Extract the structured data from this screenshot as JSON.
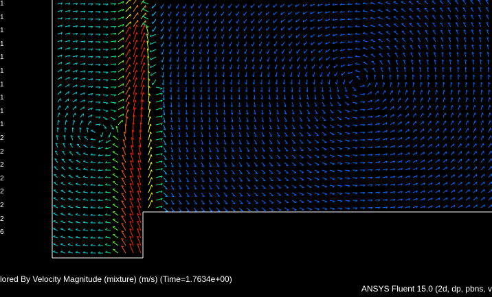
{
  "legend": {
    "labels": [
      "1",
      "1",
      "1",
      "1",
      "1",
      "1",
      "1",
      "1",
      "1",
      "1",
      "2",
      "2",
      "2",
      "2",
      "2",
      "2",
      "2",
      "6"
    ]
  },
  "caption": "lored By Velocity Magnitude (mixture)  (m/s)  (Time=1.7634e+00)",
  "footer": "ANSYS Fluent 15.0 (2d, dp, pbns, v"
}
